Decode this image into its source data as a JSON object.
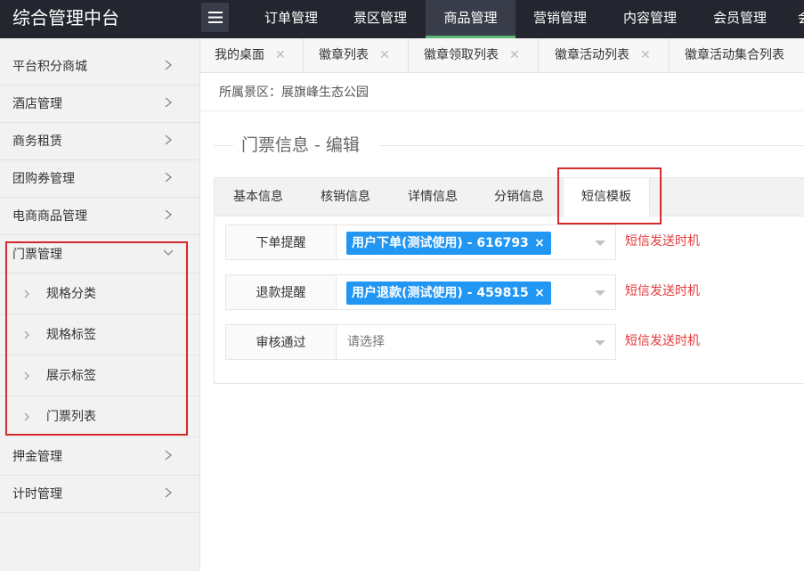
{
  "app": {
    "title": "综合管理中台"
  },
  "topnav": {
    "items": [
      {
        "label": "订单管理",
        "active": false
      },
      {
        "label": "景区管理",
        "active": false
      },
      {
        "label": "商品管理",
        "active": true
      },
      {
        "label": "营销管理",
        "active": false
      },
      {
        "label": "内容管理",
        "active": false
      },
      {
        "label": "会员管理",
        "active": false
      }
    ],
    "overflow_label": "会",
    "active_accent": "#5fb878",
    "bar_color": "#23262e"
  },
  "sidebar": {
    "items": [
      {
        "label": "平台积分商城"
      },
      {
        "label": "酒店管理"
      },
      {
        "label": "商务租赁"
      },
      {
        "label": "团购券管理"
      },
      {
        "label": "电商商品管理"
      },
      {
        "label": "门票管理",
        "expanded": true
      },
      {
        "label": "押金管理"
      },
      {
        "label": "计时管理"
      }
    ],
    "subitems": [
      {
        "label": "规格分类"
      },
      {
        "label": "规格标签"
      },
      {
        "label": "展示标签"
      },
      {
        "label": "门票列表"
      }
    ]
  },
  "tabs": [
    {
      "label": "我的桌面"
    },
    {
      "label": "徽章列表"
    },
    {
      "label": "徽章领取列表"
    },
    {
      "label": "徽章活动列表"
    },
    {
      "label": "徽章活动集合列表"
    }
  ],
  "scenic": {
    "label": "所属景区：展旗峰生态公园"
  },
  "form": {
    "title": "门票信息 - 编辑",
    "tabs": [
      {
        "label": "基本信息",
        "active": false
      },
      {
        "label": "核销信息",
        "active": false
      },
      {
        "label": "详情信息",
        "active": false
      },
      {
        "label": "分销信息",
        "active": false
      },
      {
        "label": "短信模板",
        "active": true
      }
    ],
    "rows": [
      {
        "label": "下单提醒",
        "value": "用户下单(测试使用) - 616793",
        "placeholder": "",
        "hint": "短信发送时机"
      },
      {
        "label": "退款提醒",
        "value": "用户退款(测试使用) - 459815",
        "placeholder": "",
        "hint": "短信发送时机"
      },
      {
        "label": "审核通过",
        "value": "",
        "placeholder": "请选择",
        "hint": "短信发送时机"
      }
    ],
    "chip_color": "#2196f3",
    "hint_color": "#e4393c"
  },
  "highlight_color": "#d3292f"
}
